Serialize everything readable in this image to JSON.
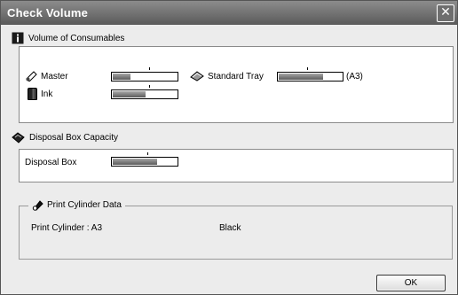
{
  "window": {
    "title": "Check Volume",
    "close_symbol": "✕"
  },
  "consumables": {
    "heading": "Volume of Consumables",
    "master": {
      "label": "Master",
      "level": 0.28
    },
    "ink": {
      "label": "Ink",
      "level": 0.52
    },
    "standard_tray": {
      "label": "Standard Tray",
      "level": 0.7,
      "paper_size": "(A3)"
    }
  },
  "disposal": {
    "heading": "Disposal Box Capacity",
    "box": {
      "label": "Disposal Box",
      "level": 0.7
    }
  },
  "cylinder": {
    "heading": "Print Cylinder Data",
    "size_label": "Print Cylinder : A3",
    "color": "Black"
  },
  "footer": {
    "ok_label": "OK"
  },
  "icons": {
    "info": "info-icon",
    "master": "master-roll-icon",
    "ink": "ink-cartridge-icon",
    "tray": "paper-tray-icon",
    "disposal": "disposal-box-icon",
    "cylinder": "print-cylinder-icon"
  }
}
